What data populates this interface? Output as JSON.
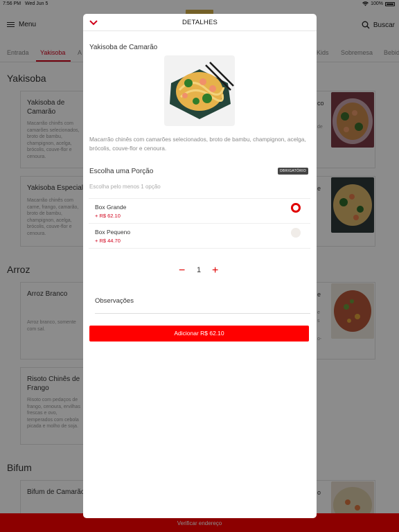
{
  "status_bar": {
    "time": "7:56 PM",
    "date": "Wed Jun 5",
    "battery": "100%"
  },
  "header": {
    "menu_label": "Menu",
    "search_label": "Buscar"
  },
  "tabs": [
    "Entrada",
    "Yakisoba",
    "A",
    "Kids",
    "Sobremesa",
    "Bebid"
  ],
  "active_tab": "Yakisoba",
  "sections": [
    {
      "title": "Yakisoba",
      "items": [
        {
          "name": "Yakisoba de Camarão",
          "desc": "Macarrão chinês com camarões selecionados, broto de bambu, champignon, acelga, brócolis, couve-flor e cenoura."
        },
        {
          "name": "Yakisoba Especial",
          "desc": "Macarrão chinês com carne, frango, camarão, broto de bambu, champignon, acelga, brócolis, couve-flor e cenoura."
        }
      ],
      "right_fragments": [
        "co",
        "de",
        "e"
      ]
    },
    {
      "title": "Arroz",
      "items": [
        {
          "name": "Arroz Branco",
          "desc": "Arroz branco, somente com sal."
        },
        {
          "name": "Risoto Chinês de Frango",
          "desc": "Risoto com pedaços de frango, cenoura, ervilhas frescas e ovo, temperados com cebola picada e molho de soja."
        }
      ],
      "right_fragments": [
        "e",
        "e",
        "s",
        "o-"
      ]
    },
    {
      "title": "Bifum",
      "items": [
        {
          "name": "Bifum de Camarão",
          "desc": ""
        }
      ],
      "right_fragments": [
        "o"
      ]
    }
  ],
  "bottom_bar": {
    "label": "Verificar endereço"
  },
  "modal": {
    "title": "DETALHES",
    "product_name": "Yakisoba de Camarão",
    "product_description": "Macarrão chinês com camarões selecionados, broto de bambu, champignon, acelga, brócolis, couve-flor e cenoura.",
    "portion": {
      "title": "Escolha uma Porção",
      "required_badge": "OBRIGATÓRIO",
      "hint": "Escolha pelo menos 1 opção",
      "options": [
        {
          "name": "Box Grande",
          "price": "+ R$ 62.10",
          "selected": true
        },
        {
          "name": "Box Pequeno",
          "price": "+ R$ 44.70",
          "selected": false
        }
      ]
    },
    "quantity": {
      "minus": "−",
      "value": "1",
      "plus": "+"
    },
    "notes_label": "Observações",
    "add_button": "Adicionar R$ 62.10"
  },
  "colors": {
    "accent": "#d0021b",
    "button": "#ff0000",
    "overlay": "rgba(0,0,0,0.45)"
  }
}
